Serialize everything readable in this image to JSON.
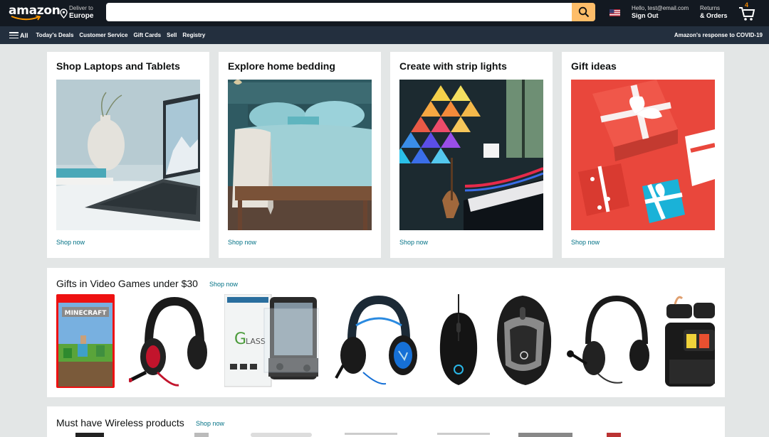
{
  "header": {
    "logo": "amazon",
    "deliver_label": "Deliver to",
    "deliver_location": "Europe",
    "search_placeholder": "",
    "account_greeting": "Hello, test@email.com",
    "account_action": "Sign Out",
    "returns_l1": "Returns",
    "returns_l2": "& Orders",
    "cart_count": "4"
  },
  "subnav": {
    "all_label": "All",
    "links": [
      "Today's Deals",
      "Customer Service",
      "Gift Cards",
      "Sell",
      "Registry"
    ],
    "covid": "Amazon's response to COVID-19"
  },
  "cards": [
    {
      "title": "Shop Laptops and Tablets",
      "link": "Shop now"
    },
    {
      "title": "Explore home bedding",
      "link": "Shop now"
    },
    {
      "title": "Create with strip lights",
      "link": "Shop now"
    },
    {
      "title": "Gift ideas",
      "link": "Shop now"
    }
  ],
  "rows": [
    {
      "title": "Gifts in Video Games under $30",
      "link": "Shop now"
    },
    {
      "title": "Must have Wireless products",
      "link": "Shop now"
    }
  ],
  "products": [
    {
      "name": "minecraft-game-case"
    },
    {
      "name": "red-gaming-headset"
    },
    {
      "name": "screen-protector-glass"
    },
    {
      "name": "blue-gaming-headset"
    },
    {
      "name": "logitech-mouse"
    },
    {
      "name": "logitech-mx-mouse"
    },
    {
      "name": "black-headset"
    },
    {
      "name": "switch-carrying-case"
    }
  ],
  "colors": {
    "header_bg": "#131921",
    "subnav_bg": "#232f3e",
    "search_button": "#febd69",
    "link": "#007185",
    "page_bg": "#e3e6e6"
  }
}
